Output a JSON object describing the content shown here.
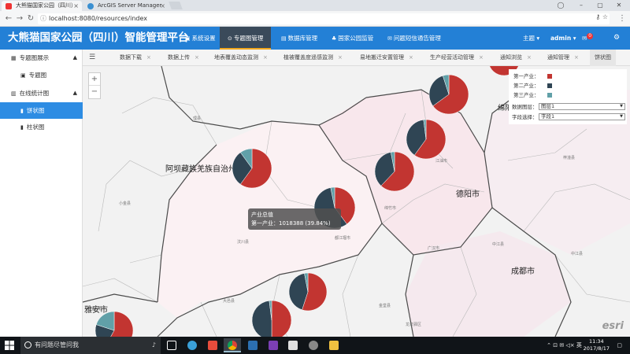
{
  "browser": {
    "tabs": [
      {
        "title": "大熊猫国家公园（四川）",
        "active": true
      },
      {
        "title": "ArcGIS Server Manager",
        "active": false
      }
    ],
    "url": "localhost:8080/resources/index"
  },
  "header": {
    "brand": "大熊猫国家公园（四川）智能管理平台",
    "nav": [
      {
        "label": "系统设置",
        "icon": "settings-icon",
        "active": false
      },
      {
        "label": "专题图管理",
        "icon": "target-icon",
        "active": true
      },
      {
        "label": "数据库管理",
        "icon": "database-icon",
        "active": false
      },
      {
        "label": "国家公园监管",
        "icon": "tree-icon",
        "active": false
      },
      {
        "label": "问题短信通告管理",
        "icon": "message-icon",
        "active": false
      }
    ],
    "theme_label": "主题",
    "user_label": "admin",
    "mail_count": "0"
  },
  "sidebar": {
    "items": [
      {
        "label": "专题图展示",
        "icon": "image-icon",
        "level": 0
      },
      {
        "label": "专题图",
        "icon": "map-icon",
        "level": 1
      },
      {
        "label": "在线统计图",
        "icon": "chart-icon",
        "level": 0
      },
      {
        "label": "饼状图",
        "icon": "pie-icon",
        "level": 1,
        "active": true
      },
      {
        "label": "柱状图",
        "icon": "bar-icon",
        "level": 1
      }
    ]
  },
  "content_tabs": [
    "数据下载",
    "数据上传",
    "地表覆盖动态监测",
    "植被覆盖度遥感监测",
    "易地搬迁安置管理",
    "生产经营活动管理",
    "通知浏览",
    "通知管理",
    "饼状图"
  ],
  "map": {
    "zoom_in": "+",
    "zoom_out": "−",
    "place_labels": {
      "aba": "阿坝藏族羌族自治州",
      "deyang": "德阳市",
      "chengdu": "成都市",
      "yaan": "雅安市",
      "mianyang": "绵阳"
    },
    "tooltip": {
      "title": "产业总值",
      "line": "第一产业：1018388 (39.84%)"
    },
    "attribution": "esri"
  },
  "legend": {
    "items": [
      {
        "label": "第一产业：",
        "color": "#c23531"
      },
      {
        "label": "第二产业：",
        "color": "#2f4554"
      },
      {
        "label": "第三产业：",
        "color": "#61a0a8"
      }
    ],
    "layer_label": "数据图层：",
    "layer_value": "图层1",
    "field_label": "字段选择：",
    "field_value": "字段1"
  },
  "taskbar": {
    "search_placeholder": "有问题尽管问我",
    "time": "11:34",
    "date": "2017/8/17",
    "ime": "英"
  }
}
